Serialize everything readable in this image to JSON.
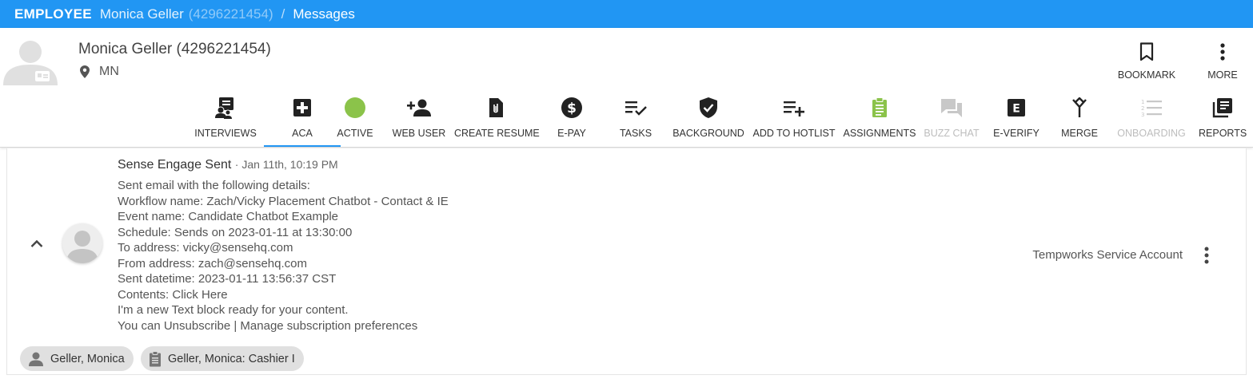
{
  "topbar": {
    "record_type": "EMPLOYEE",
    "employee_name": "Monica Geller",
    "employee_id": "(4296221454)",
    "separator": "/",
    "page": "Messages"
  },
  "header": {
    "title": "Monica Geller (4296221454)",
    "location": "MN",
    "actions": {
      "bookmark": "BOOKMARK",
      "more": "MORE"
    }
  },
  "toolbar": {
    "interviews": "INTERVIEWS",
    "aca": "ACA",
    "active": "ACTIVE",
    "web_user": "WEB USER",
    "create_resume": "CREATE RESUME",
    "epay": "E-PAY",
    "tasks": "TASKS",
    "background": "BACKGROUND",
    "add_to_hotlist": "ADD TO HOTLIST",
    "assignments": "ASSIGNMENTS",
    "buzz_chat": "BUZZ CHAT",
    "everify": "E-VERIFY",
    "merge": "MERGE",
    "onboarding": "ONBOARDING",
    "reports": "REPORTS"
  },
  "colors": {
    "topbar": "#2196f3",
    "active_status": "#8bc34a",
    "assignments_icon": "#8bc34a",
    "disabled": "#bdbdbd",
    "selected_tab_underline": "#2196f3"
  },
  "message": {
    "title": "Sense Engage Sent",
    "datetime": "· Jan 11th, 10:19 PM",
    "lines": [
      "Sent email with the following details:",
      "Workflow name: Zach/Vicky Placement Chatbot - Contact & IE",
      "Event name: Candidate Chatbot Example",
      "Schedule: Sends on 2023-01-11 at 13:30:00",
      "To address: vicky@sensehq.com",
      "From address: zach@sensehq.com",
      "Sent datetime: 2023-01-11 13:56:37 CST",
      "Contents: Click Here",
      "I'm a new Text block ready for your content.",
      "You can Unsubscribe | Manage subscription preferences"
    ],
    "author": "Tempworks Service Account",
    "tags": [
      {
        "label": "Geller, Monica",
        "icon": "person-icon"
      },
      {
        "label": "Geller, Monica: Cashier I",
        "icon": "clipboard-icon"
      }
    ]
  }
}
